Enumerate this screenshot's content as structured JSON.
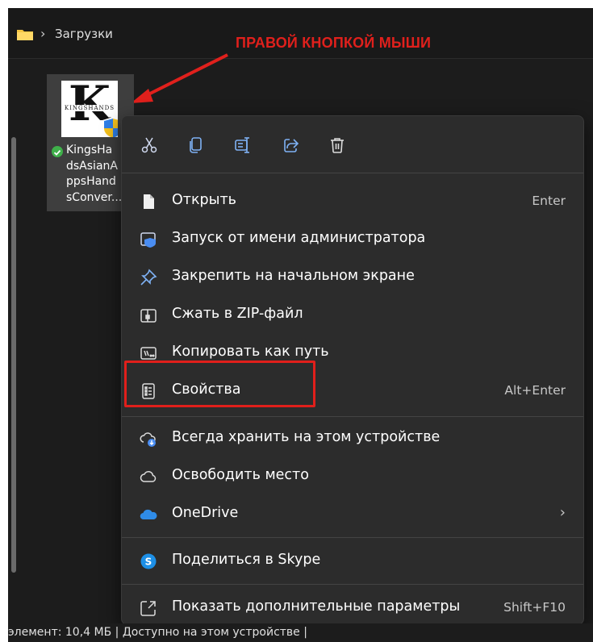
{
  "window": {
    "address_bar": {
      "folder_icon": "folder-icon",
      "crumb": "Загрузки"
    }
  },
  "annotation": {
    "text": "ПРАВОЙ КНОПКОЙ МЫШИ",
    "color": "#e0201c"
  },
  "file_tile": {
    "name_lines": [
      "KingsHa",
      "dsAsianA",
      "ppsHand",
      "sConver..."
    ],
    "thumbnail_letter": "K",
    "thumbnail_brand": "KINGSHANDS",
    "status_icon": "sync-ok-icon"
  },
  "context_menu": {
    "toolbar": [
      {
        "name": "cut",
        "icon": "scissors-icon"
      },
      {
        "name": "copy",
        "icon": "copy-icon"
      },
      {
        "name": "rename",
        "icon": "rename-icon"
      },
      {
        "name": "share",
        "icon": "share-icon"
      },
      {
        "name": "delete",
        "icon": "trash-icon"
      }
    ],
    "items": [
      {
        "label": "Открыть",
        "shortcut": "Enter",
        "icon": "file-icon"
      },
      {
        "label": "Запуск от имени администратора",
        "shortcut": "",
        "icon": "admin-shield-icon"
      },
      {
        "label": "Закрепить на начальном экране",
        "shortcut": "",
        "icon": "pin-icon"
      },
      {
        "label": "Сжать в ZIP-файл",
        "shortcut": "",
        "icon": "zip-icon"
      },
      {
        "label": "Копировать как путь",
        "shortcut": "",
        "icon": "path-icon"
      },
      {
        "label": "Свойства",
        "shortcut": "Alt+Enter",
        "icon": "properties-icon"
      },
      {
        "label": "Всегда хранить на этом устройстве",
        "shortcut": "",
        "icon": "cloud-keep-icon"
      },
      {
        "label": "Освободить место",
        "shortcut": "",
        "icon": "cloud-icon"
      },
      {
        "label": "OneDrive",
        "shortcut": "",
        "icon": "onedrive-icon"
      },
      {
        "label": "Поделиться в Skype",
        "shortcut": "",
        "icon": "skype-icon"
      },
      {
        "label": "Показать дополнительные параметры",
        "shortcut": "Shift+F10",
        "icon": "more-options-icon"
      }
    ],
    "highlight_color": "#e11f1b"
  },
  "status_bar": {
    "text": "элемент: 10,4 МБ  |  Доступно на этом устройстве  |"
  }
}
